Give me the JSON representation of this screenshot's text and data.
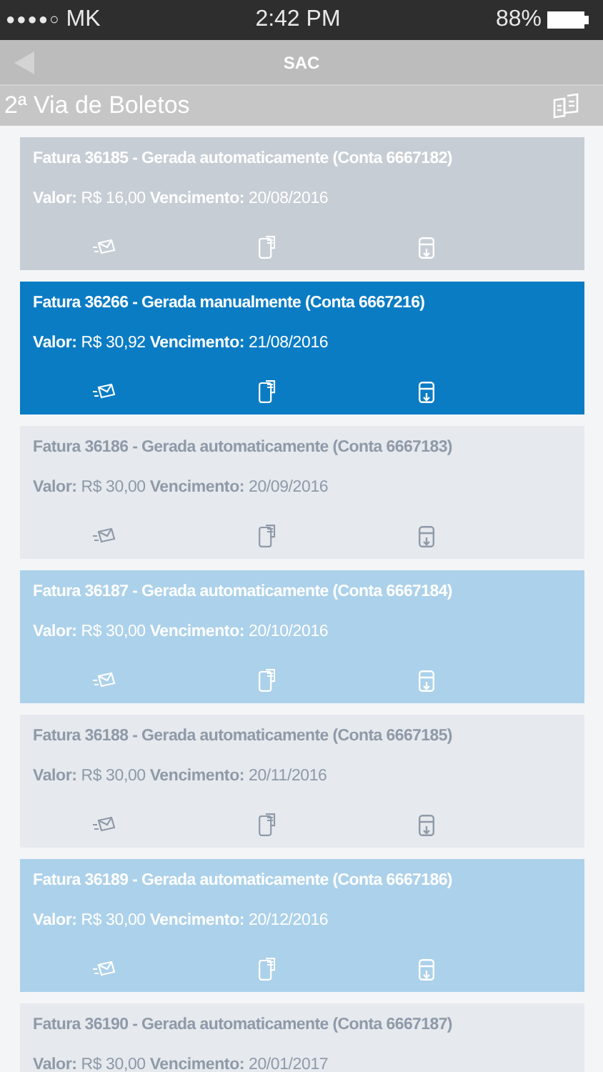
{
  "status_bar": {
    "signal": "●●●●○",
    "carrier": "MK",
    "time": "2:42 PM",
    "battery": "88%"
  },
  "nav": {
    "title": "SAC"
  },
  "header": {
    "title": "2ª Via de Boletos"
  },
  "cards": [
    {
      "kind": "grey",
      "selected": false,
      "title": "Fatura 36185 - Gerada automaticamente (Conta 6667182)",
      "details": "**Valor:** R$ 16,00 **Vencimento:** 20/08/2016"
    },
    {
      "selected": true,
      "title": "Fatura 36266 - Gerada manualmente (Conta 6667216)",
      "details": "**Valor:** R$ 30,92 **Vencimento:** 21/08/2016"
    },
    {
      "kind": "pale",
      "selected": false,
      "title": "Fatura 36186 - Gerada automaticamente (Conta 6667183)",
      "details": "**Valor:** R$ 30,00 **Vencimento:** 20/09/2016"
    },
    {
      "kind": "light",
      "selected": false,
      "title": "Fatura 36187 - Gerada automaticamente (Conta 6667184)",
      "details": "**Valor:** R$ 30,00 **Vencimento:** 20/10/2016"
    },
    {
      "kind": "pale",
      "selected": false,
      "title": "Fatura 36188 - Gerada automaticamente (Conta 6667185)",
      "details": "**Valor:** R$ 30,00 **Vencimento:** 20/11/2016"
    },
    {
      "kind": "light",
      "selected": false,
      "title": "Fatura 36189 - Gerada automaticamente (Conta 6667186)",
      "details": "**Valor:** R$ 30,00 **Vencimento:** 20/12/2016"
    },
    {
      "kind": "pale",
      "selected": false,
      "title": "Fatura 36190 - Gerada automaticamente (Conta 6667187)",
      "details": "**Valor:** R$ 30,00 **Vencimento:** 20/01/2017"
    }
  ]
}
